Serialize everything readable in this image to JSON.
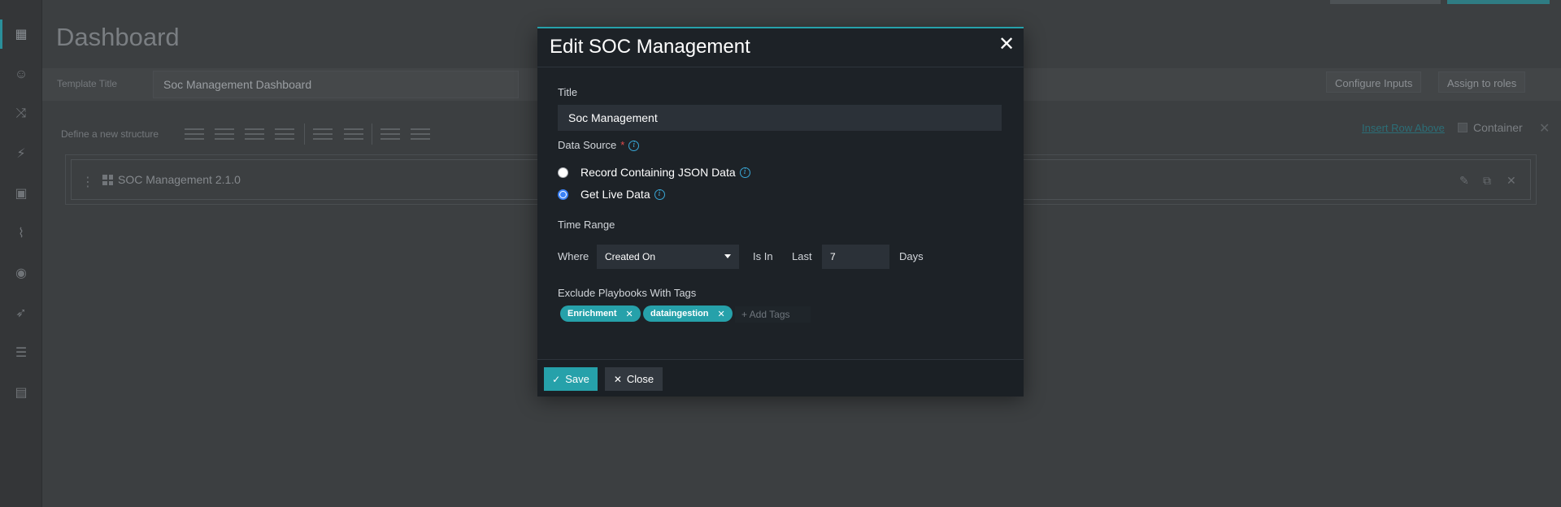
{
  "background": {
    "page_title": "Dashboard",
    "template_title_label": "Template Title",
    "template_title_value": "Soc Management Dashboard",
    "configure_inputs": "Configure Inputs",
    "assign_to_roles": "Assign to roles",
    "define_structure_label": "Define a new structure",
    "insert_row_above": "Insert Row Above",
    "container_label": "Container",
    "widget_title": "SOC Management 2.1.0"
  },
  "modal": {
    "title": "Edit SOC Management",
    "close_glyph": "✕",
    "title_label": "Title",
    "title_value": "Soc Management",
    "data_source_label": "Data Source",
    "required_mark": "*",
    "info_glyph": "i",
    "radios": [
      {
        "label": "Record Containing JSON Data",
        "checked": false
      },
      {
        "label": "Get Live Data",
        "checked": true
      }
    ],
    "time_range_label": "Time Range",
    "where_label": "Where",
    "field_select": "Created On",
    "is_in_label": "Is In",
    "last_label": "Last",
    "last_value": "7",
    "unit_label": "Days",
    "exclude_label": "Exclude Playbooks With Tags",
    "tags": [
      "Enrichment",
      "dataingestion"
    ],
    "add_tags_placeholder": "+ Add Tags",
    "save_label": "Save",
    "close_label": "Close"
  },
  "colors": {
    "accent": "#26a1aa",
    "modal_bg": "#1d2227",
    "overlay_bg": "#3c3f41",
    "required": "#e24b4b",
    "info": "#39a7d6"
  },
  "icons": [
    "dashboard-icon",
    "close-icon",
    "info-icon",
    "check-icon",
    "caret-down-icon",
    "edit-icon",
    "copy-icon",
    "kebab-icon"
  ]
}
